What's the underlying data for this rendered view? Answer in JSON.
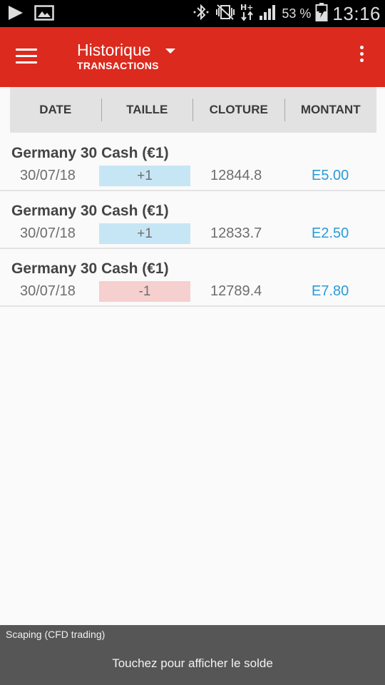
{
  "status_bar": {
    "battery_percent": "53 %",
    "time": "13:16",
    "icons": [
      "play-icon",
      "image-icon",
      "bluetooth-icon",
      "vibrate-icon",
      "hplus-data-icon",
      "signal-icon",
      "battery-charging-icon"
    ]
  },
  "app_bar": {
    "title": "Historique",
    "subtitle": "TRANSACTIONS",
    "background_color": "#dc2a1e"
  },
  "columns": [
    "DATE",
    "TAILLE",
    "CLOTURE",
    "MONTANT"
  ],
  "transactions": [
    {
      "name": "Germany 30 Cash (€1)",
      "date": "30/07/18",
      "size": "+1",
      "direction": "positive",
      "close": "12844.8",
      "amount": "E5.00"
    },
    {
      "name": "Germany 30 Cash (€1)",
      "date": "30/07/18",
      "size": "+1",
      "direction": "positive",
      "close": "12833.7",
      "amount": "E2.50"
    },
    {
      "name": "Germany 30 Cash (€1)",
      "date": "30/07/18",
      "size": "-1",
      "direction": "negative",
      "close": "12789.4",
      "amount": "E7.80"
    }
  ],
  "colors": {
    "positive_size_bg": "#c7e6f5",
    "negative_size_bg": "#f6cfcf",
    "amount_text": "#2a9bd7"
  },
  "footer": {
    "account_name": "Scaping (CFD trading)",
    "cta": "Touchez pour afficher le solde"
  }
}
